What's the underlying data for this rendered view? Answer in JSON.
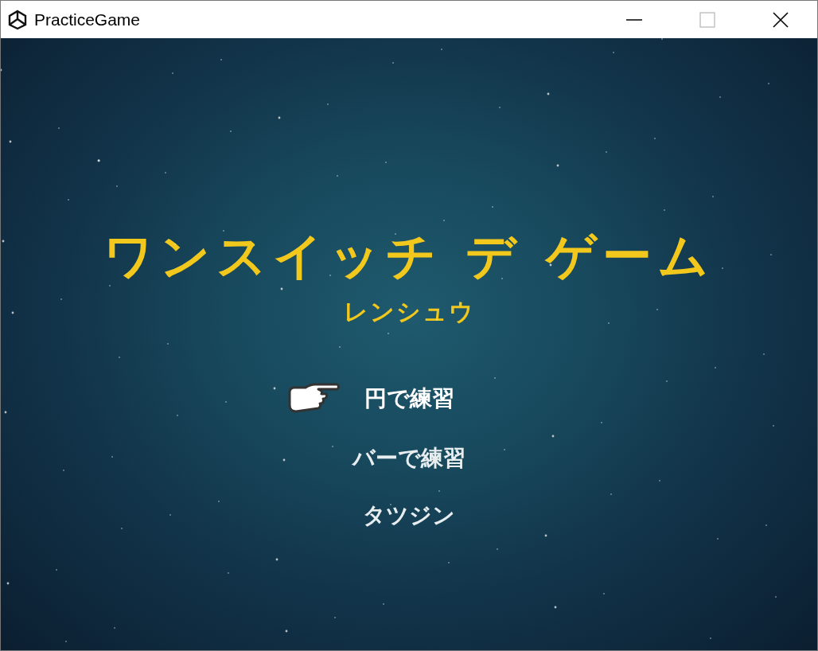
{
  "window": {
    "title": "PracticeGame"
  },
  "game": {
    "title": "ワンスイッチ デ ゲーム",
    "subtitle": "レンシュウ",
    "menu": [
      {
        "label": "円で練習",
        "selected": true
      },
      {
        "label": "バーで練習",
        "selected": false
      },
      {
        "label": "タツジン",
        "selected": false
      }
    ]
  }
}
